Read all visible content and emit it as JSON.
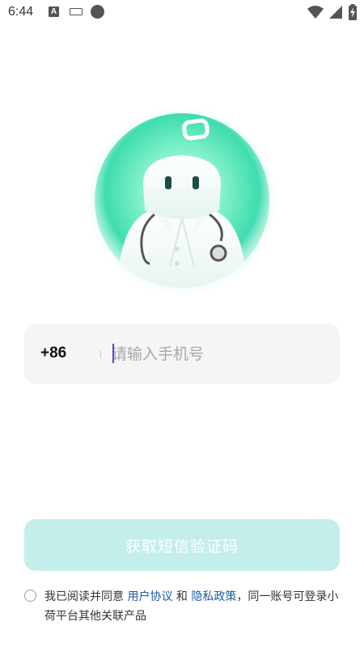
{
  "status_bar": {
    "time": "6:44",
    "icons": [
      "text-a-icon",
      "keyboard-icon",
      "record-dot-icon",
      "wifi-icon",
      "cellular-signal-icon",
      "battery-charging-icon"
    ]
  },
  "mascot": {
    "name": "doctor-mascot-illustration"
  },
  "phone": {
    "country_code": "+86",
    "placeholder": "请输入手机号",
    "value": ""
  },
  "button": {
    "label": "获取短信验证码"
  },
  "agreement": {
    "prefix": "我已阅读并同意 ",
    "link_terms": "用户协议",
    "connector": " 和 ",
    "link_privacy": "隐私政策",
    "suffix": "，同一账号可登录小荷平台其他关联产品"
  },
  "colors": {
    "accent_mint": "#4fe0b4",
    "button_disabled_bg": "#c4eeea",
    "link_blue": "#1d5aa8",
    "input_bg": "#f5f5f5",
    "caret_purple": "#5a46c6"
  }
}
